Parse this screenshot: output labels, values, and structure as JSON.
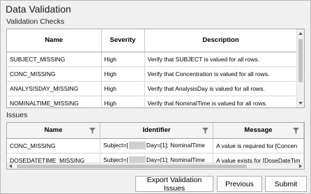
{
  "window": {
    "title": "Data Validation"
  },
  "checks": {
    "label": "Validation Checks",
    "columns": [
      "Name",
      "Severity",
      "Description"
    ],
    "rows": [
      [
        "SUBJECT_MISSING",
        "High",
        "Verify that SUBJECT is valued for all rows."
      ],
      [
        "CONC_MISSING",
        "High",
        "Verify that Concentration is valued for all rows."
      ],
      [
        "ANALYSISDAY_MISSING",
        "High",
        "Verify that AnalysisDay is valued for all rows."
      ],
      [
        "NOMINALTIME_MISSING",
        "High",
        "Verify that NominalTime is valued for all rows."
      ]
    ]
  },
  "issues": {
    "label": "Issues",
    "columns": [
      "Name",
      "Identifier",
      "Message"
    ],
    "rows": [
      {
        "name": "CONC_MISSING",
        "id_prefix": "Subject=[",
        "id_suffix": "Day=[1]; NominalTime",
        "message": "A value is required for [Concen"
      },
      {
        "name": "DOSEDATETIME_MISSING",
        "id_prefix": "Subject=[",
        "id_suffix": "Day=[1]; NominalTime",
        "message": "A value exists for [DoseDateTim"
      }
    ]
  },
  "buttons": {
    "export": "Export Validation Issues",
    "previous": "Previous",
    "submit": "Submit"
  },
  "icons": {
    "filter": "filter-icon"
  }
}
